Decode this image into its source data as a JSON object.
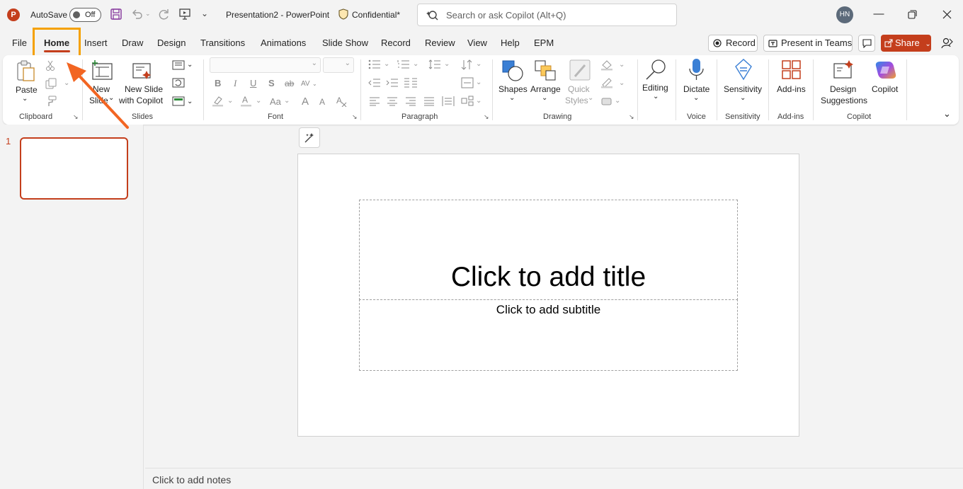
{
  "titlebar": {
    "autosave_label": "AutoSave",
    "autosave_state": "Off",
    "doc_title": "Presentation2  -  PowerPoint",
    "sensitivity": "Confidential*",
    "search_placeholder": "Search or ask Copilot (Alt+Q)",
    "user_initials": "HN"
  },
  "tabs": [
    "File",
    "Home",
    "Insert",
    "Draw",
    "Design",
    "Transitions",
    "Animations",
    "Slide Show",
    "Record",
    "Review",
    "View",
    "Help",
    "EPM"
  ],
  "active_tab": "Home",
  "top_buttons": {
    "record": "Record",
    "present": "Present in Teams",
    "share": "Share"
  },
  "ribbon": {
    "clipboard": {
      "label": "Clipboard",
      "paste": "Paste"
    },
    "slides": {
      "label": "Slides",
      "new_slide": "New",
      "new_slide_2": "Slide",
      "new_with_copilot": "New Slide",
      "new_with_copilot_2": "with Copilot"
    },
    "font": {
      "label": "Font",
      "bold": "B",
      "italic": "I",
      "underline": "U",
      "strike": "S",
      "abc": "ab",
      "change_case": "Aa",
      "grow": "A",
      "shrink": "A"
    },
    "paragraph": {
      "label": "Paragraph"
    },
    "drawing": {
      "label": "Drawing",
      "shapes": "Shapes",
      "arrange": "Arrange",
      "quick_styles": "Quick",
      "quick_styles_2": "Styles"
    },
    "editing": {
      "label": "Editing"
    },
    "voice": {
      "label": "Voice",
      "dictate": "Dictate"
    },
    "sensitivity": {
      "label": "Sensitivity",
      "button": "Sensitivity"
    },
    "addins": {
      "label": "Add-ins",
      "button": "Add-ins"
    },
    "copilot": {
      "label": "Copilot",
      "design": "Design",
      "design_2": "Suggestions",
      "copilot": "Copilot"
    }
  },
  "thumbnail": {
    "number": "1"
  },
  "slide": {
    "title_placeholder": "Click to add title",
    "subtitle_placeholder": "Click to add subtitle"
  },
  "notes_placeholder": "Click to add notes",
  "colors": {
    "accent": "#c43e1c",
    "highlight": "#f5a100",
    "arrow": "#f26522"
  }
}
